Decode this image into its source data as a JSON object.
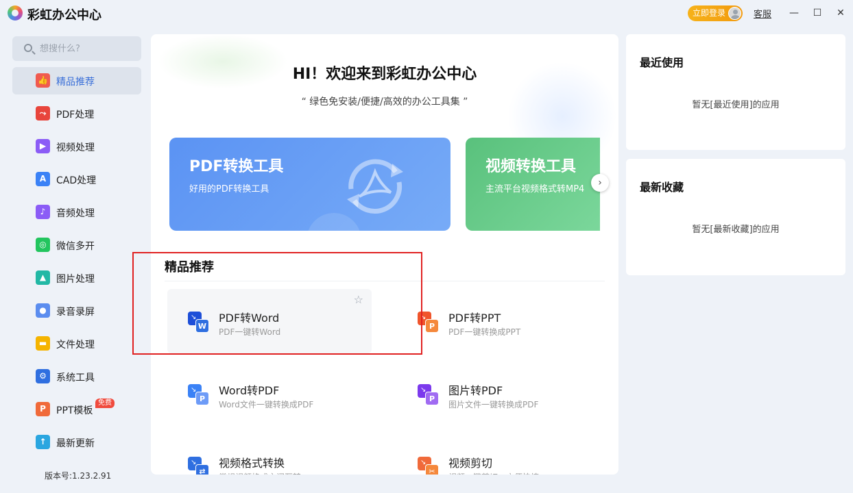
{
  "app": {
    "title": "彩虹办公中心",
    "login_label": "立即登录",
    "service_label": "客服",
    "win_min": "—",
    "win_max": "☐",
    "win_close": "✕"
  },
  "search": {
    "placeholder": "想搜什么?"
  },
  "sidebar": {
    "items": [
      {
        "label": "精品推荐",
        "icon": "thumbs-up-icon",
        "color": "#f05a4f",
        "glyph": "👍"
      },
      {
        "label": "PDF处理",
        "icon": "pdf-icon",
        "color": "#e8453c",
        "glyph": "⤳"
      },
      {
        "label": "视频处理",
        "icon": "video-icon",
        "color": "#8b5cf6",
        "glyph": "▶"
      },
      {
        "label": "CAD处理",
        "icon": "cad-icon",
        "color": "#3b82f6",
        "glyph": "A"
      },
      {
        "label": "音频处理",
        "icon": "audio-icon",
        "color": "#8b5cf6",
        "glyph": "♪"
      },
      {
        "label": "微信多开",
        "icon": "wechat-icon",
        "color": "#22c55e",
        "glyph": "◎"
      },
      {
        "label": "图片处理",
        "icon": "image-icon",
        "color": "#22b8a5",
        "glyph": "▲"
      },
      {
        "label": "录音录屏",
        "icon": "microphone-icon",
        "color": "#5b8def",
        "glyph": "●"
      },
      {
        "label": "文件处理",
        "icon": "folder-icon",
        "color": "#f5b400",
        "glyph": "▬"
      },
      {
        "label": "系统工具",
        "icon": "gear-icon",
        "color": "#2f6fe0",
        "glyph": "⚙"
      },
      {
        "label": "PPT模板",
        "icon": "ppt-icon",
        "color": "#f06a3a",
        "glyph": "P",
        "badge": "免费"
      },
      {
        "label": "最新更新",
        "icon": "upload-icon",
        "color": "#2aa6e0",
        "glyph": "↑"
      }
    ]
  },
  "version": "版本号:1.23.2.91",
  "main": {
    "welcome": "HI！欢迎来到彩虹办公中心",
    "slogan": "“ 绿色免安装/便捷/高效的办公工具集 ”",
    "banners": [
      {
        "title": "PDF转换工具",
        "subtitle": "好用的PDF转换工具"
      },
      {
        "title": "视频转换工具",
        "subtitle": "主流平台视频格式转MP4"
      }
    ],
    "next": "›",
    "section_title": "精品推荐",
    "tools": [
      {
        "name": "PDF转Word",
        "desc": "PDF一键转Word",
        "letter": "W",
        "back": "#1d4ed8",
        "front": "#2f6fe0"
      },
      {
        "name": "PDF转PPT",
        "desc": "PDF一键转换成PPT",
        "letter": "P",
        "back": "#f0552c",
        "front": "#f5883c"
      },
      {
        "name": "Word转PDF",
        "desc": "Word文件一键转换成PDF",
        "letter": "P",
        "back": "#3b82f6",
        "front": "#6d9bf7"
      },
      {
        "name": "图片转PDF",
        "desc": "图片文件一键转换成PDF",
        "letter": "P",
        "back": "#7c3aed",
        "front": "#a06bf2"
      },
      {
        "name": "视频格式转换",
        "desc": "常规视频格式之间互转",
        "letter": "⇄",
        "back": "#2f6fe0",
        "front": "#2f6fe0"
      },
      {
        "name": "视频剪切",
        "desc": "视频一键剪切，方便快捷",
        "letter": "✂",
        "back": "#f06a3a",
        "front": "#f5883c"
      }
    ]
  },
  "right": {
    "recent_title": "最近使用",
    "recent_empty": "暂无[最近使用]的应用",
    "fav_title": "最新收藏",
    "fav_empty": "暂无[最新收藏]的应用"
  }
}
